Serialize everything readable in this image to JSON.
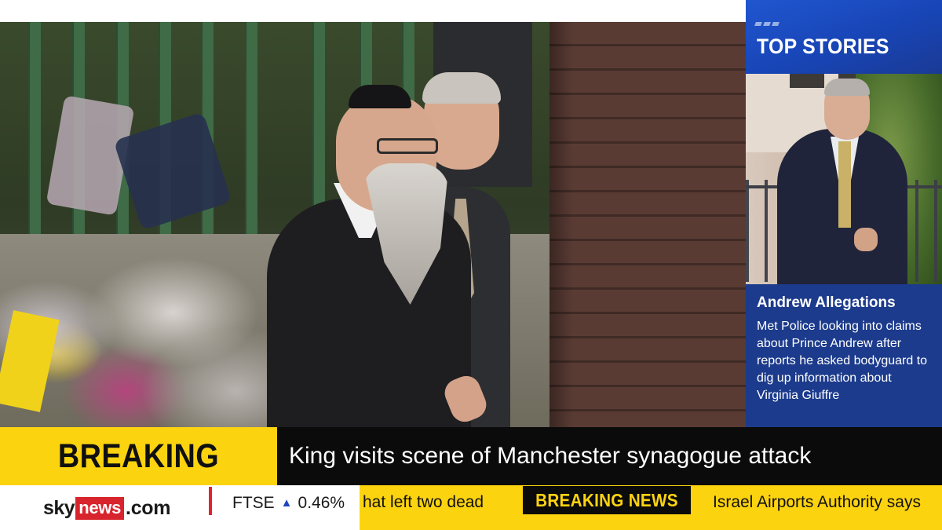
{
  "top_stories": {
    "heading": "TOP STORIES",
    "story": {
      "title": "Andrew Allegations",
      "body": "Met Police looking into claims about Prince Andrew after reports he asked bodyguard to dig up information about Virginia Giuffre"
    }
  },
  "strap": {
    "label": "BREAKING NEWS",
    "headline": "King visits scene of Manchester synagogue attack"
  },
  "ticker": {
    "brand": {
      "sky": "sky",
      "news": "news",
      "com": ".com"
    },
    "market": {
      "index": "FTSE",
      "direction_icon": "up-triangle-icon",
      "direction_glyph": "▲",
      "change": "0.46%"
    },
    "items": [
      {
        "text": "hat left two dead"
      },
      {
        "text": "BREAKING NEWS"
      },
      {
        "text": "Israel Airports Authority says"
      }
    ]
  },
  "colors": {
    "breaking_yellow": "#fcd30f",
    "panel_blue": "#1c3d8f",
    "brand_red": "#d8242c",
    "up_blue": "#2146c2"
  }
}
